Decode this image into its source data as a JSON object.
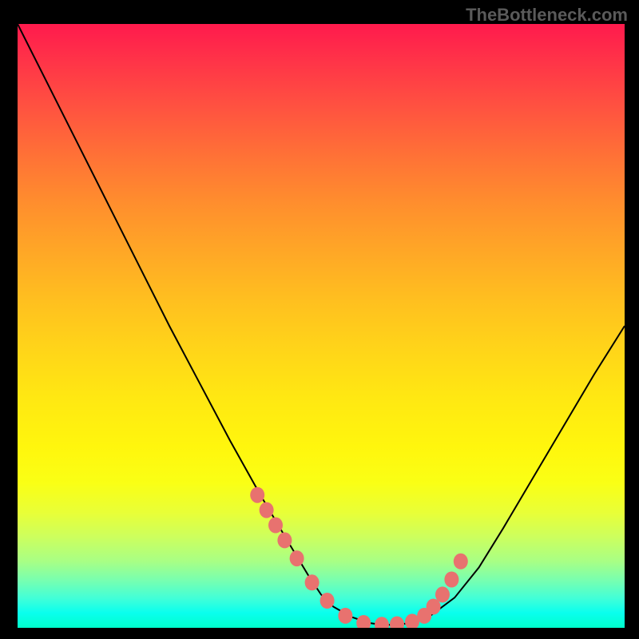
{
  "watermark": "TheBottleneck.com",
  "chart_data": {
    "type": "line",
    "title": "",
    "xlabel": "",
    "ylabel": "",
    "x_range": [
      0,
      100
    ],
    "y_range": [
      0,
      100
    ],
    "series": [
      {
        "name": "bottleneck-curve",
        "x": [
          0,
          5,
          10,
          15,
          20,
          25,
          30,
          35,
          40,
          45,
          48,
          50,
          52,
          55,
          58,
          60,
          62,
          65,
          68,
          72,
          76,
          80,
          85,
          90,
          95,
          100
        ],
        "y": [
          100,
          90,
          80,
          70,
          60,
          50,
          40.5,
          31,
          22,
          13.5,
          8.5,
          5.5,
          3.5,
          1.8,
          0.8,
          0.5,
          0.5,
          0.8,
          2,
          5,
          10,
          16.5,
          25,
          33.5,
          42,
          50
        ]
      }
    ],
    "data_points": {
      "name": "highlighted-points",
      "x": [
        39.5,
        41,
        42.5,
        44,
        46,
        48.5,
        51,
        54,
        57,
        60,
        62.5,
        65,
        67,
        68.5,
        70,
        71.5,
        73
      ],
      "y": [
        22,
        19.5,
        17,
        14.5,
        11.5,
        7.5,
        4.5,
        2,
        0.8,
        0.5,
        0.6,
        1,
        2,
        3.5,
        5.5,
        8,
        11
      ]
    },
    "background": {
      "type": "vertical-gradient",
      "top_color": "#ff1a4d",
      "middle_color": "#ffe812",
      "bottom_color": "#00ffcc"
    }
  }
}
